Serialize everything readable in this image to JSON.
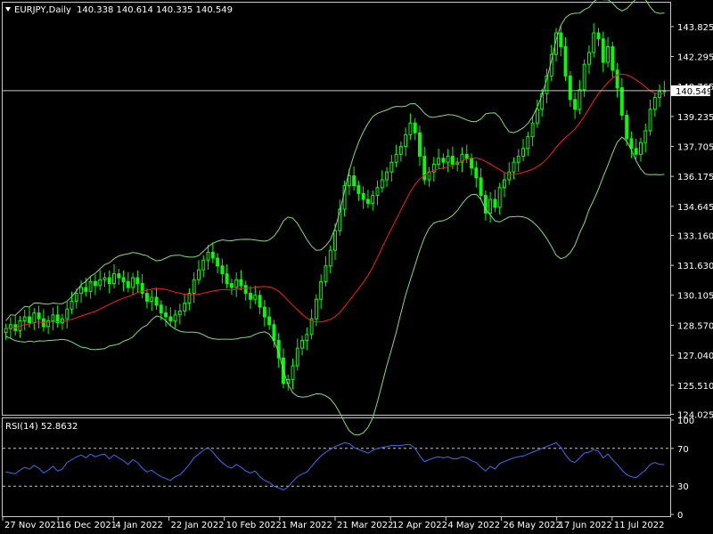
{
  "header": {
    "symbol_label": "EURJPY,Daily",
    "ohlc_text": "140.338 140.614 140.335 140.549",
    "rsi_label": "RSI(14) 52.8632"
  },
  "colors": {
    "background": "#000000",
    "candle": "#00ff00",
    "bands": "#7fdc7f",
    "ma": "#ff1a1a",
    "rsi": "#3a6df0",
    "grid_text": "#ffffff"
  },
  "chart_data": [
    {
      "type": "candlestick",
      "title": "EURJPY,Daily",
      "price_axis_ticks": [
        "143.825",
        "142.295",
        "140.765",
        "139.235",
        "137.705",
        "136.175",
        "134.645",
        "133.160",
        "131.630",
        "130.105",
        "128.570",
        "127.040",
        "125.510",
        "124.025"
      ],
      "ylim": [
        124.0,
        145.0
      ],
      "last_price_label": "140.549",
      "date_labels": [
        "27 Nov 2021",
        "16 Dec 2021",
        "4 Jan 2022",
        "22 Jan 2022",
        "10 Feb 2022",
        "1 Mar 2022",
        "21 Mar 2022",
        "12 Apr 2022",
        "4 May 2022",
        "26 May 2022",
        "17 Jun 2022",
        "11 Jul 2022"
      ],
      "series": [
        {
          "name": "close",
          "values": [
            128.4,
            128.6,
            128.3,
            128.8,
            129.0,
            128.7,
            129.2,
            128.9,
            128.5,
            128.8,
            129.1,
            128.7,
            128.9,
            129.4,
            129.8,
            130.2,
            130.5,
            130.3,
            130.8,
            130.6,
            130.9,
            131.0,
            130.7,
            131.2,
            131.0,
            130.8,
            130.5,
            131.0,
            130.7,
            130.2,
            129.8,
            130.0,
            129.6,
            129.2,
            129.0,
            128.8,
            129.1,
            129.3,
            129.7,
            130.2,
            130.9,
            131.4,
            131.9,
            132.3,
            132.0,
            131.6,
            131.2,
            130.7,
            130.5,
            130.9,
            130.6,
            130.2,
            129.9,
            130.1,
            129.5,
            129.0,
            128.6,
            127.8,
            126.9,
            125.6,
            125.8,
            126.5,
            127.4,
            127.8,
            128.1,
            128.9,
            129.9,
            130.8,
            131.6,
            132.4,
            133.4,
            134.5,
            135.7,
            136.2,
            135.7,
            135.3,
            135.0,
            134.8,
            135.2,
            135.6,
            136.0,
            136.4,
            136.9,
            137.3,
            137.7,
            138.3,
            138.9,
            138.4,
            137.2,
            136.0,
            136.4,
            136.8,
            137.1,
            136.9,
            137.2,
            136.8,
            136.9,
            137.3,
            137.1,
            136.6,
            136.1,
            135.2,
            134.3,
            135.0,
            134.6,
            135.6,
            136.0,
            136.4,
            136.9,
            137.2,
            137.6,
            138.2,
            138.9,
            139.6,
            140.4,
            141.3,
            142.4,
            143.5,
            142.8,
            141.3,
            140.1,
            139.6,
            140.6,
            141.9,
            142.5,
            143.5,
            143.2,
            142.0,
            142.8,
            141.6,
            140.7,
            139.3,
            138.1,
            137.6,
            137.3,
            137.9,
            138.5,
            139.6,
            140.2,
            140.5,
            140.549
          ]
        }
      ]
    },
    {
      "type": "line",
      "title": "RSI(14) 52.8632",
      "rsi_axis_ticks": [
        "100",
        "70",
        "30",
        "0"
      ],
      "ylim": [
        0,
        100
      ],
      "levels": [
        70,
        30
      ],
      "series": [
        {
          "name": "RSI(14)",
          "values": [
            45,
            44,
            43,
            47,
            50,
            48,
            52,
            49,
            44,
            47,
            51,
            46,
            48,
            55,
            58,
            61,
            63,
            60,
            64,
            61,
            63,
            64,
            59,
            63,
            60,
            57,
            53,
            58,
            55,
            49,
            45,
            47,
            43,
            40,
            38,
            36,
            40,
            42,
            47,
            53,
            60,
            64,
            68,
            71,
            66,
            60,
            55,
            51,
            49,
            53,
            50,
            46,
            44,
            46,
            40,
            36,
            34,
            30,
            28,
            26,
            29,
            35,
            40,
            43,
            45,
            51,
            57,
            62,
            66,
            69,
            72,
            74,
            76,
            75,
            71,
            69,
            67,
            65,
            68,
            70,
            71,
            72,
            73,
            73,
            73,
            74,
            74,
            70,
            62,
            56,
            58,
            60,
            61,
            60,
            61,
            59,
            59,
            61,
            60,
            57,
            55,
            50,
            46,
            51,
            48,
            54,
            56,
            58,
            60,
            61,
            62,
            64,
            66,
            68,
            70,
            72,
            74,
            76,
            71,
            63,
            57,
            55,
            60,
            65,
            66,
            69,
            67,
            60,
            64,
            58,
            53,
            47,
            42,
            40,
            39,
            43,
            47,
            53,
            55,
            53,
            52.86
          ]
        }
      ]
    }
  ]
}
